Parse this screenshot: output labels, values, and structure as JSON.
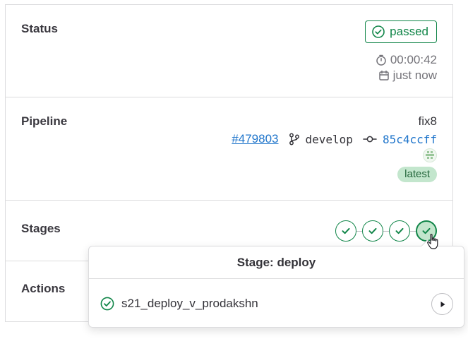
{
  "status": {
    "label": "Status",
    "badge": "passed",
    "duration": "00:00:42",
    "finished": "just now"
  },
  "pipeline": {
    "label": "Pipeline",
    "name": "fix8",
    "id_link": "#479803",
    "branch": "develop",
    "commit_sha": "85c4ccff",
    "badge": "latest"
  },
  "stages": {
    "label": "Stages",
    "items": [
      {
        "icon": "status-success-icon"
      },
      {
        "icon": "status-success-icon"
      },
      {
        "icon": "status-success-icon"
      },
      {
        "icon": "status-success-icon",
        "active": true
      }
    ]
  },
  "actions": {
    "label": "Actions"
  },
  "stage_dropdown": {
    "title": "Stage: deploy",
    "jobs": [
      {
        "name": "s21_deploy_v_prodakshn",
        "status": "success",
        "action": "play"
      }
    ]
  },
  "colors": {
    "success": "#108548",
    "link": "#1f75cb",
    "latest_bg": "#c3e6cd"
  }
}
